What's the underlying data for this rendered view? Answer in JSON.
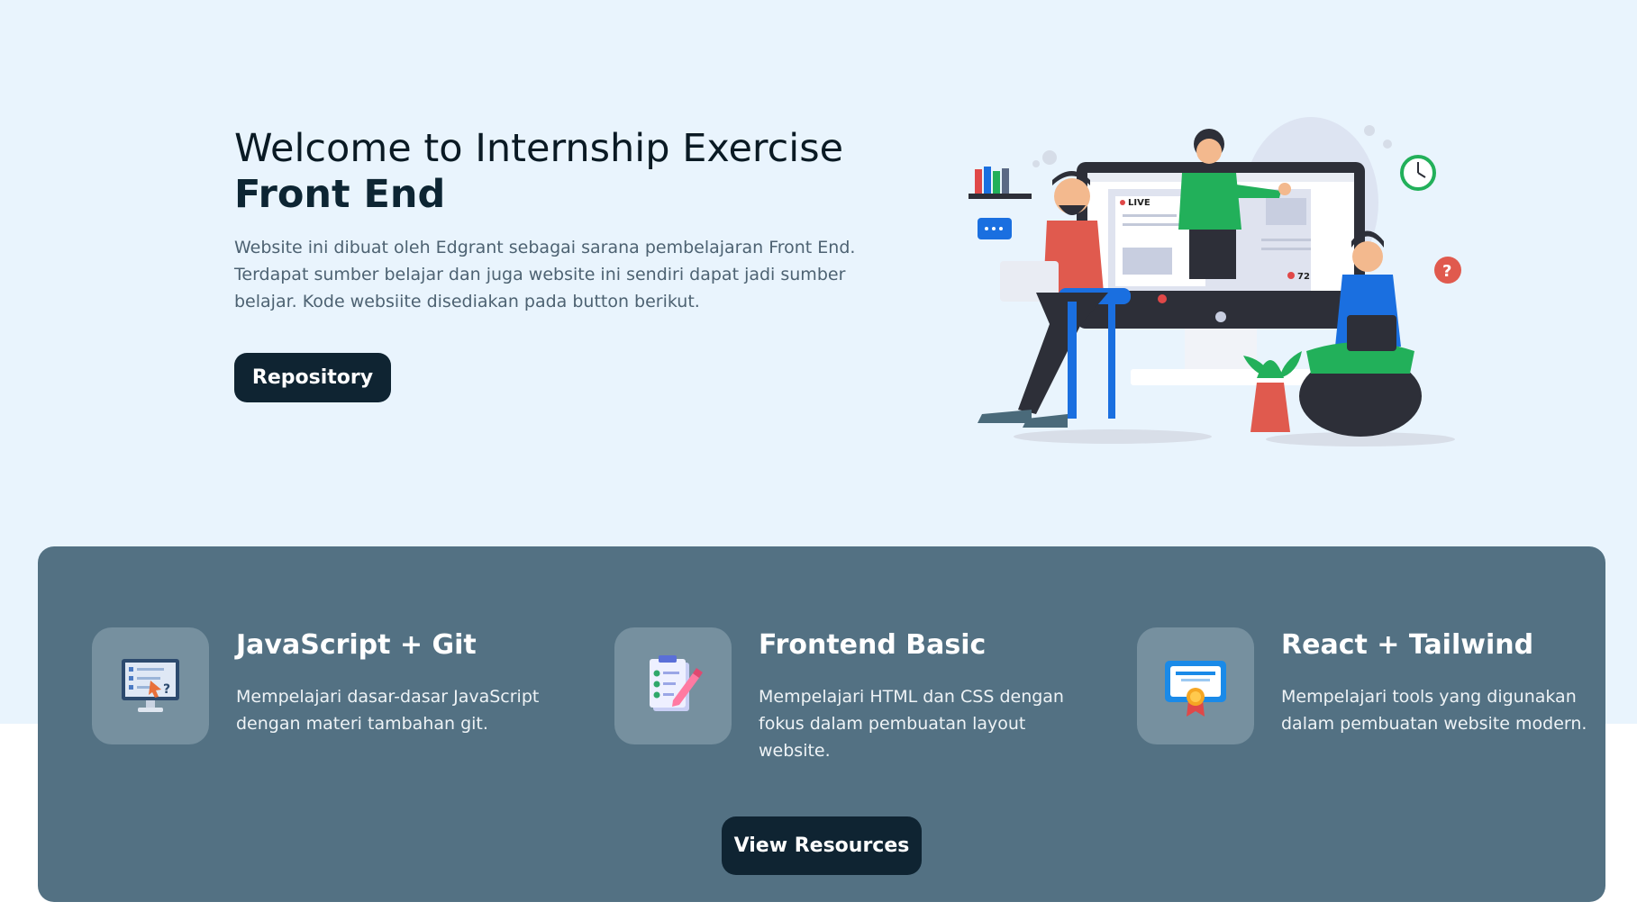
{
  "hero": {
    "title_line1": "Welcome to Internship Exercise",
    "title_line2": "Front End",
    "description": "Website ini dibuat oleh Edgrant sebagai sarana pembelajaran Front End. Terdapat sumber belajar dan juga website ini sendiri dapat jadi sumber belajar. Kode websiite disediakan pada button berikut.",
    "button_label": "Repository",
    "illustration": {
      "live_label": "LIVE",
      "viewer_count": "72",
      "icon": "online-class-illustration"
    }
  },
  "features": {
    "items": [
      {
        "title": "JavaScript + Git",
        "description": "Mempelajari dasar-dasar JavaScript dengan materi tambahan git.",
        "icon": "quiz-monitor-icon"
      },
      {
        "title": "Frontend Basic",
        "description": "Mempelajari HTML dan CSS dengan fokus dalam pembuatan layout website.",
        "icon": "checklist-document-icon"
      },
      {
        "title": "React + Tailwind",
        "description": "Mempelajari tools yang digunakan dalam pembuatan website modern.",
        "icon": "certificate-icon"
      }
    ],
    "button_label": "View Resources"
  },
  "colors": {
    "hero_bg": "#e9f4fd",
    "card_bg": "#537183",
    "button_bg": "#0f2432",
    "accent_green": "#22b05a",
    "accent_blue": "#1a6fe0"
  }
}
